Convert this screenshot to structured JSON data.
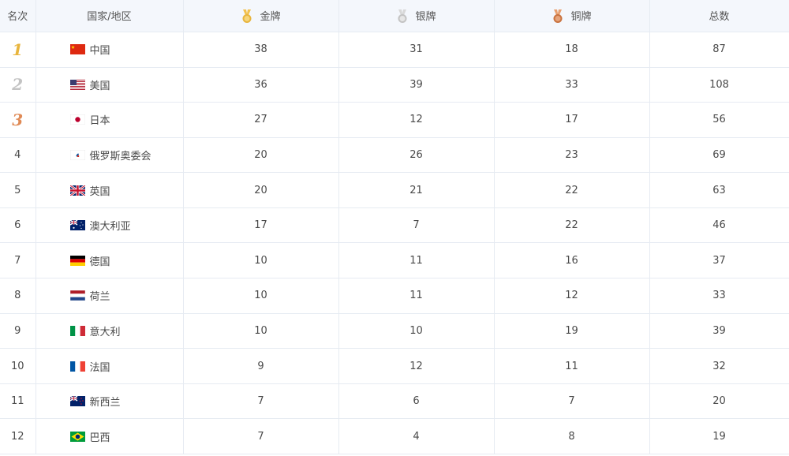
{
  "headers": {
    "rank": "名次",
    "country": "国家/地区",
    "gold": "金牌",
    "silver": "银牌",
    "bronze": "铜牌",
    "total": "总数"
  },
  "medal_icons": {
    "gold": "gold-medal-icon",
    "silver": "silver-medal-icon",
    "bronze": "bronze-medal-icon"
  },
  "colors": {
    "gold": "#e8b53d",
    "silver": "#c3c3c3",
    "bronze": "#e08a55",
    "header_bg": "#f4f7fc",
    "grid": "#e6ebf2"
  },
  "rows": [
    {
      "rank": "1",
      "country": "中国",
      "flag": "china-flag-icon",
      "gold": "38",
      "silver": "31",
      "bronze": "18",
      "total": "87"
    },
    {
      "rank": "2",
      "country": "美国",
      "flag": "usa-flag-icon",
      "gold": "36",
      "silver": "39",
      "bronze": "33",
      "total": "108"
    },
    {
      "rank": "3",
      "country": "日本",
      "flag": "japan-flag-icon",
      "gold": "27",
      "silver": "12",
      "bronze": "17",
      "total": "56"
    },
    {
      "rank": "4",
      "country": "俄罗斯奥委会",
      "flag": "roc-flag-icon",
      "gold": "20",
      "silver": "26",
      "bronze": "23",
      "total": "69"
    },
    {
      "rank": "5",
      "country": "英国",
      "flag": "uk-flag-icon",
      "gold": "20",
      "silver": "21",
      "bronze": "22",
      "total": "63"
    },
    {
      "rank": "6",
      "country": "澳大利亚",
      "flag": "australia-flag-icon",
      "gold": "17",
      "silver": "7",
      "bronze": "22",
      "total": "46"
    },
    {
      "rank": "7",
      "country": "德国",
      "flag": "germany-flag-icon",
      "gold": "10",
      "silver": "11",
      "bronze": "16",
      "total": "37"
    },
    {
      "rank": "8",
      "country": "荷兰",
      "flag": "netherlands-flag-icon",
      "gold": "10",
      "silver": "11",
      "bronze": "12",
      "total": "33"
    },
    {
      "rank": "9",
      "country": "意大利",
      "flag": "italy-flag-icon",
      "gold": "10",
      "silver": "10",
      "bronze": "19",
      "total": "39"
    },
    {
      "rank": "10",
      "country": "法国",
      "flag": "france-flag-icon",
      "gold": "9",
      "silver": "12",
      "bronze": "11",
      "total": "32"
    },
    {
      "rank": "11",
      "country": "新西兰",
      "flag": "new-zealand-flag-icon",
      "gold": "7",
      "silver": "6",
      "bronze": "7",
      "total": "20"
    },
    {
      "rank": "12",
      "country": "巴西",
      "flag": "brazil-flag-icon",
      "gold": "7",
      "silver": "4",
      "bronze": "8",
      "total": "19"
    }
  ]
}
